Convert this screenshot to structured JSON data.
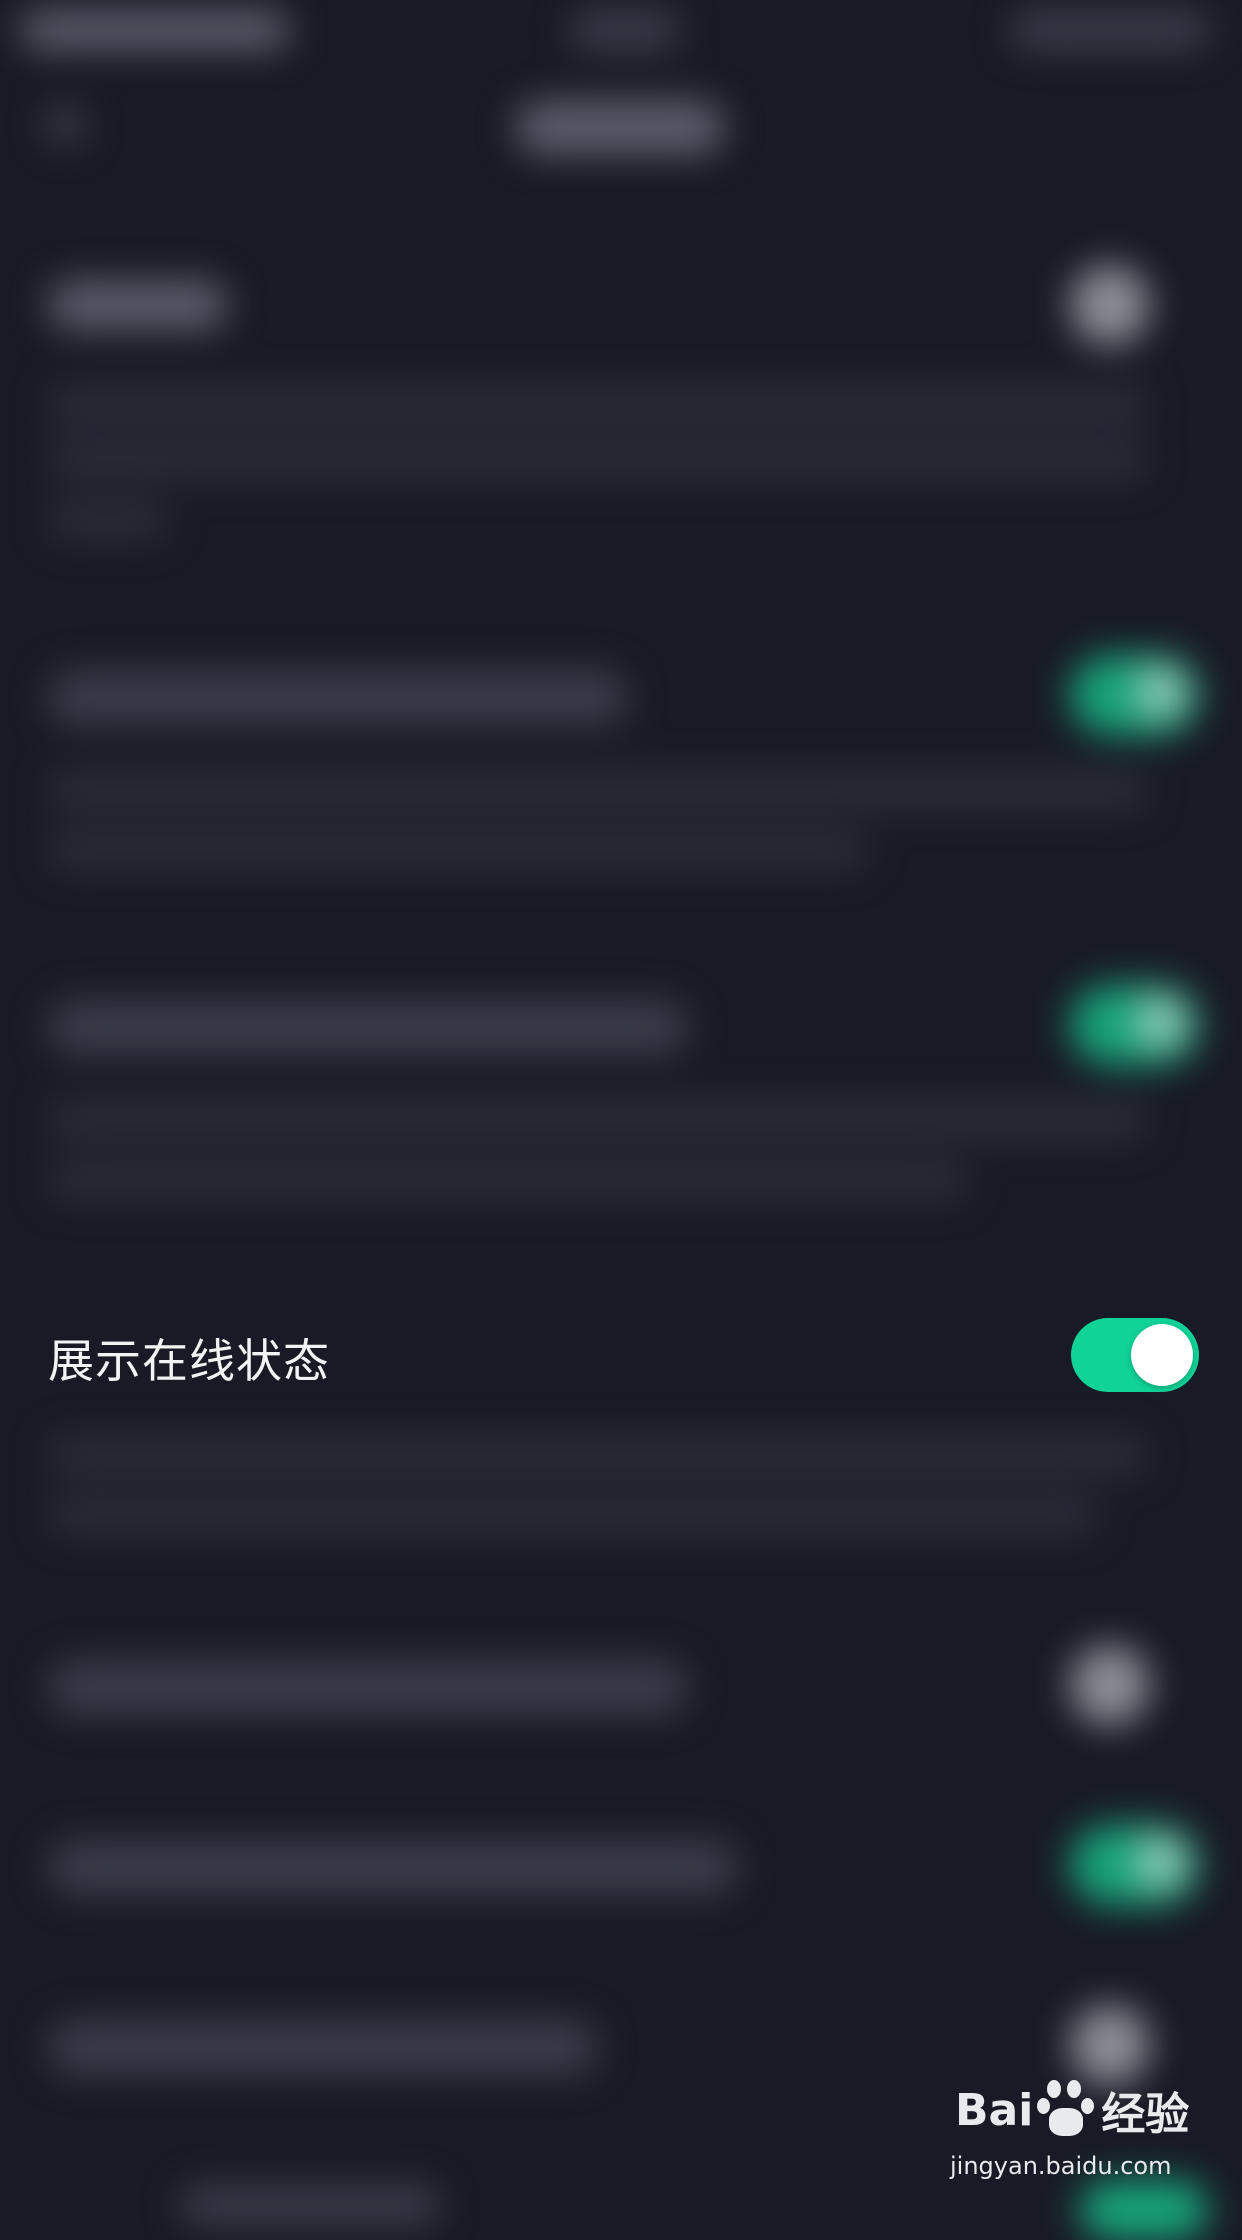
{
  "colors": {
    "background": "#181b25",
    "accent_green": "#10d397",
    "text": "#f2f3f5"
  },
  "setting": {
    "label": "展示在线状态",
    "enabled": true
  },
  "watermark": {
    "brand_left": "Bai",
    "brand_right": "经验",
    "url": "jingyan.baidu.com"
  }
}
